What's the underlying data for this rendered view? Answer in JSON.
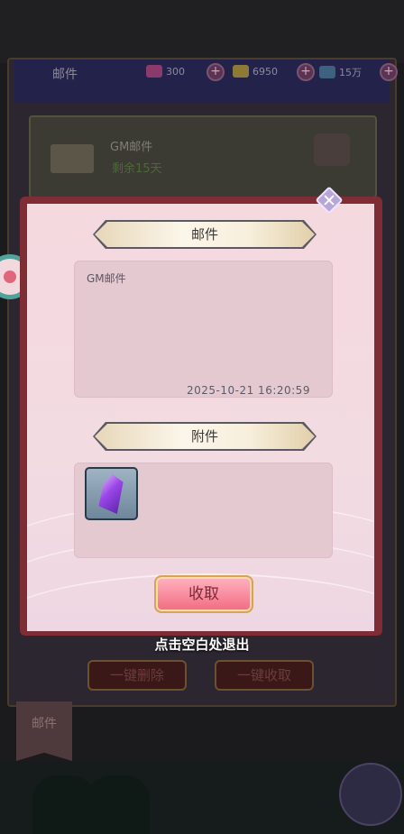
{
  "background": {
    "title": "邮件",
    "resources": [
      {
        "icon": "gem-icon",
        "value": "300",
        "color": "#b04a86"
      },
      {
        "icon": "gold-icon",
        "value": "6950",
        "color": "#b89a3a"
      },
      {
        "icon": "book-icon",
        "value": "15万",
        "color": "#4a7aa0"
      }
    ],
    "mail_item": {
      "title": "GM邮件",
      "remaining": "剩余15天"
    },
    "buttons": {
      "delete_all": "一键删除",
      "collect_all": "一键收取"
    },
    "tab": "邮件"
  },
  "dialog": {
    "mail_header": "邮件",
    "mail_title": "GM邮件",
    "mail_date": "2025-10-21 16:20:59",
    "attachment_header": "附件",
    "attachment_item": "crystal-icon",
    "collect_label": "收取",
    "exit_hint": "点击空白处退出"
  }
}
